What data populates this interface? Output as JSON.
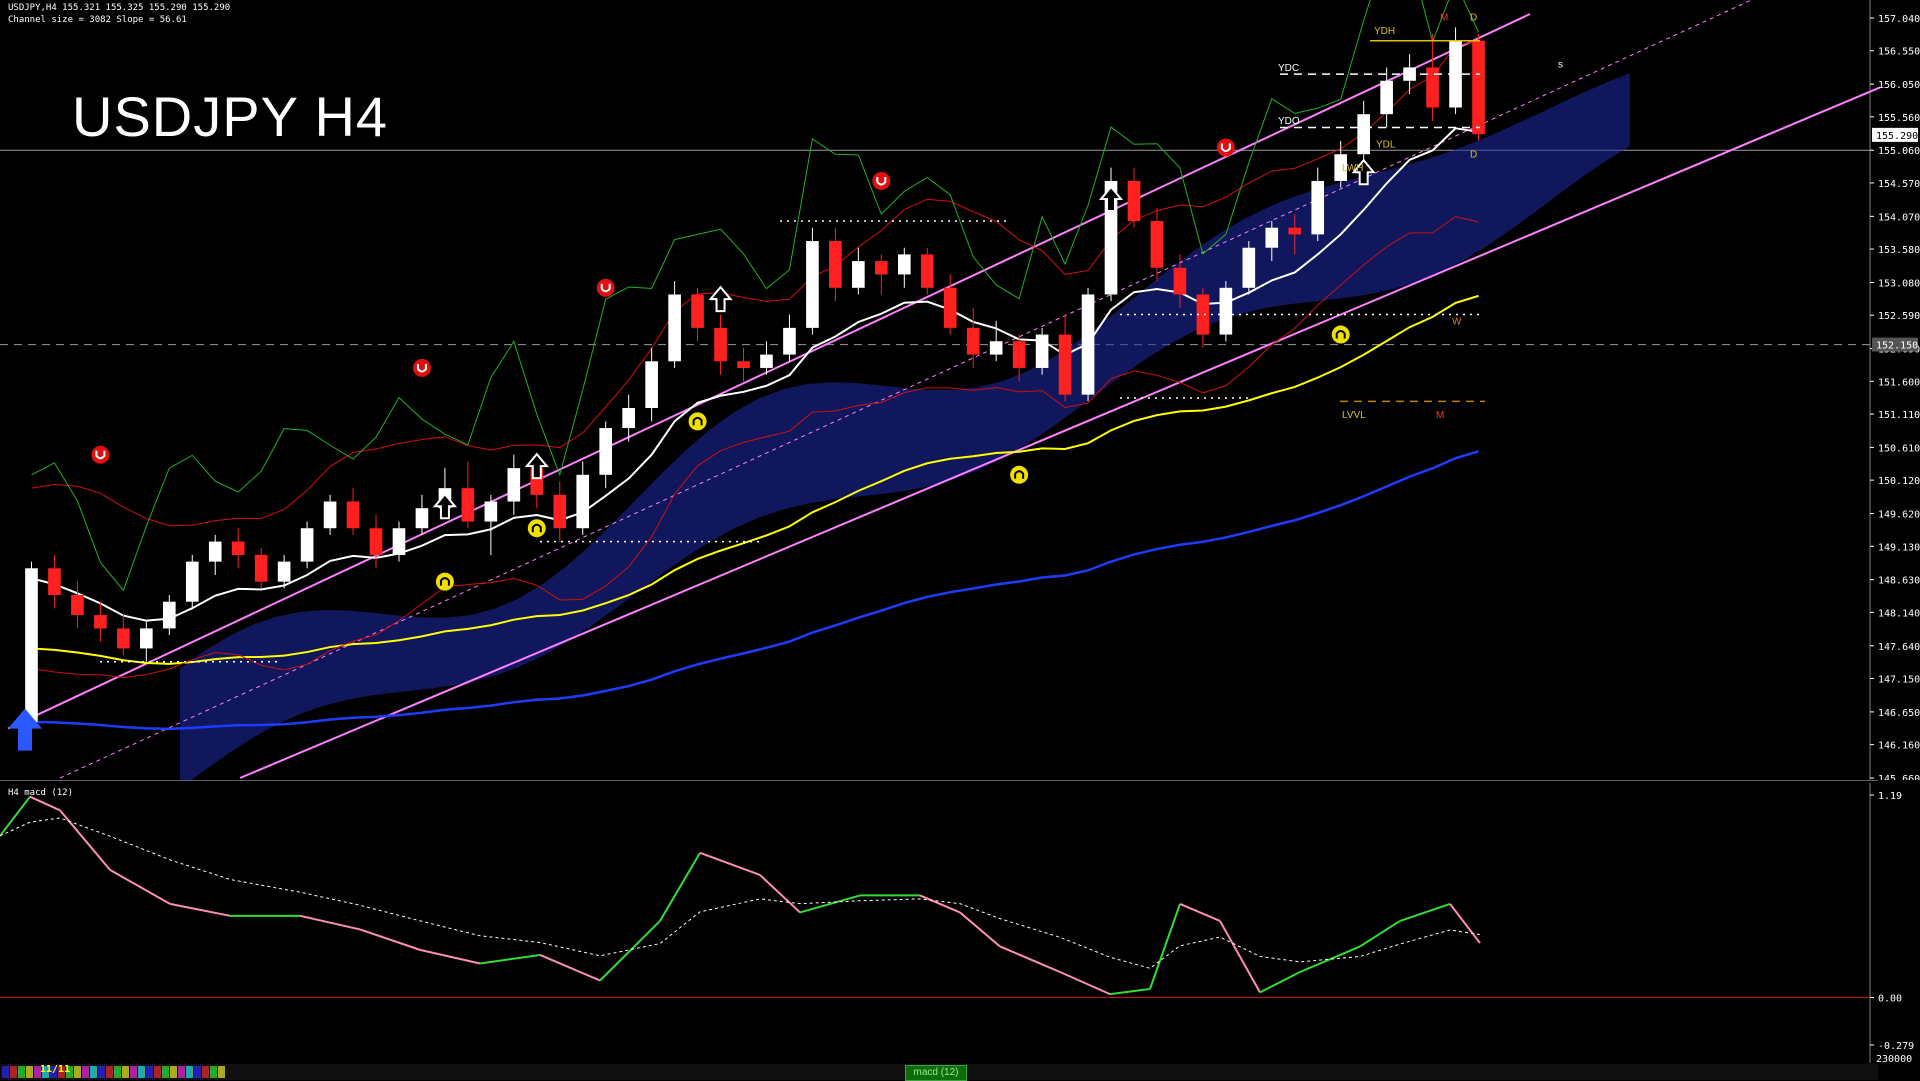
{
  "window": {
    "symbol_line": "USDJPY,H4  155.321 155.325 155.290 155.290",
    "channel_line": "Channel size = 3082 Slope = 56.61",
    "big_title": "USDJPY H4"
  },
  "macd_panel": {
    "label": "H4  macd (12)",
    "y_ticks": [
      "1.19",
      "0.00",
      "-0.279"
    ],
    "bottom_value": "230000",
    "tab_label": "macd (12)"
  },
  "bottom_bar": {
    "date_label": "11/11"
  },
  "colors": {
    "background": "#000000",
    "bull_candle": "#ffffff",
    "bear_candle": "#ff2020",
    "ma_white": "#ffffff",
    "ma_yellow": "#ffff00",
    "ma_blue": "#1e3cff",
    "channel": "#ff80ff",
    "bands": "#d01010",
    "chikou": "#22b022",
    "cloud": "#1e2aa8",
    "macd_up": "#33dd33",
    "macd_down": "#ff8fb0",
    "macd_signal": "#ffffff"
  },
  "chart_data": {
    "type": "candlestick",
    "title": "USDJPY H4",
    "price_axis_ticks": [
      "157.040",
      "156.550",
      "156.050",
      "155.560",
      "155.060",
      "154.570",
      "154.070",
      "153.580",
      "153.080",
      "152.590",
      "152.090",
      "151.600",
      "151.110",
      "150.610",
      "150.120",
      "149.620",
      "149.130",
      "148.630",
      "148.140",
      "147.640",
      "147.150",
      "146.650",
      "146.160",
      "145.660"
    ],
    "ylim": [
      145.66,
      157.04
    ],
    "current_price": "155.290",
    "marker_price": "152.150",
    "candles": [
      [
        146.5,
        148.9,
        146.3,
        148.8
      ],
      [
        148.8,
        149.0,
        148.2,
        148.4
      ],
      [
        148.4,
        148.6,
        147.9,
        148.1
      ],
      [
        148.1,
        148.3,
        147.7,
        147.9
      ],
      [
        147.9,
        148.1,
        147.5,
        147.6
      ],
      [
        147.6,
        148.0,
        147.4,
        147.9
      ],
      [
        147.9,
        148.4,
        147.8,
        148.3
      ],
      [
        148.3,
        149.0,
        148.2,
        148.9
      ],
      [
        148.9,
        149.3,
        148.7,
        149.2
      ],
      [
        149.2,
        149.4,
        148.8,
        149.0
      ],
      [
        149.0,
        149.1,
        148.5,
        148.6
      ],
      [
        148.6,
        149.0,
        148.5,
        148.9
      ],
      [
        148.9,
        149.5,
        148.8,
        149.4
      ],
      [
        149.4,
        149.9,
        149.3,
        149.8
      ],
      [
        149.8,
        150.0,
        149.3,
        149.4
      ],
      [
        149.4,
        149.6,
        148.8,
        149.0
      ],
      [
        149.0,
        149.5,
        148.9,
        149.4
      ],
      [
        149.4,
        149.9,
        149.3,
        149.7
      ],
      [
        149.7,
        150.3,
        149.6,
        150.0
      ],
      [
        150.0,
        150.4,
        149.4,
        149.5
      ],
      [
        149.5,
        149.9,
        149.0,
        149.8
      ],
      [
        149.8,
        150.5,
        149.6,
        150.3
      ],
      [
        150.3,
        150.5,
        149.7,
        149.9
      ],
      [
        149.9,
        150.1,
        149.2,
        149.4
      ],
      [
        149.4,
        150.4,
        149.3,
        150.2
      ],
      [
        150.2,
        151.0,
        150.0,
        150.9
      ],
      [
        150.9,
        151.4,
        150.7,
        151.2
      ],
      [
        151.2,
        152.1,
        151.0,
        151.9
      ],
      [
        151.9,
        153.1,
        151.8,
        152.9
      ],
      [
        152.9,
        153.0,
        152.2,
        152.4
      ],
      [
        152.4,
        152.6,
        151.7,
        151.9
      ],
      [
        151.9,
        152.1,
        151.6,
        151.8
      ],
      [
        151.8,
        152.2,
        151.7,
        152.0
      ],
      [
        152.0,
        152.6,
        151.9,
        152.4
      ],
      [
        152.4,
        153.9,
        152.3,
        153.7
      ],
      [
        153.7,
        153.9,
        152.8,
        153.0
      ],
      [
        153.0,
        153.6,
        152.9,
        153.4
      ],
      [
        153.4,
        153.5,
        152.9,
        153.2
      ],
      [
        153.2,
        153.6,
        153.0,
        153.5
      ],
      [
        153.5,
        153.6,
        152.9,
        153.0
      ],
      [
        153.0,
        153.2,
        152.3,
        152.4
      ],
      [
        152.4,
        152.7,
        151.8,
        152.0
      ],
      [
        152.0,
        152.5,
        151.9,
        152.2
      ],
      [
        152.2,
        152.3,
        151.6,
        151.8
      ],
      [
        151.8,
        152.4,
        151.7,
        152.3
      ],
      [
        152.3,
        152.6,
        151.3,
        151.4
      ],
      [
        151.4,
        153.0,
        151.3,
        152.9
      ],
      [
        152.9,
        154.8,
        152.8,
        154.6
      ],
      [
        154.6,
        154.8,
        153.9,
        154.0
      ],
      [
        154.0,
        154.2,
        153.1,
        153.3
      ],
      [
        153.3,
        153.5,
        152.7,
        152.9
      ],
      [
        152.9,
        153.0,
        152.1,
        152.3
      ],
      [
        152.3,
        153.1,
        152.2,
        153.0
      ],
      [
        153.0,
        153.7,
        152.9,
        153.6
      ],
      [
        153.6,
        154.0,
        153.4,
        153.9
      ],
      [
        153.9,
        154.1,
        153.5,
        153.8
      ],
      [
        153.8,
        154.8,
        153.7,
        154.6
      ],
      [
        154.6,
        155.2,
        154.5,
        155.0
      ],
      [
        155.0,
        155.8,
        154.9,
        155.6
      ],
      [
        155.6,
        156.3,
        155.4,
        156.1
      ],
      [
        156.1,
        156.5,
        155.9,
        156.3
      ],
      [
        156.3,
        156.8,
        155.5,
        155.7
      ],
      [
        155.7,
        156.9,
        155.6,
        156.7
      ],
      [
        156.7,
        156.8,
        155.2,
        155.3
      ]
    ],
    "annotations": [
      "YDH",
      "YDC",
      "YDO",
      "YDL",
      "LWH",
      "LVVL",
      "M",
      "W",
      "D",
      "s"
    ]
  }
}
